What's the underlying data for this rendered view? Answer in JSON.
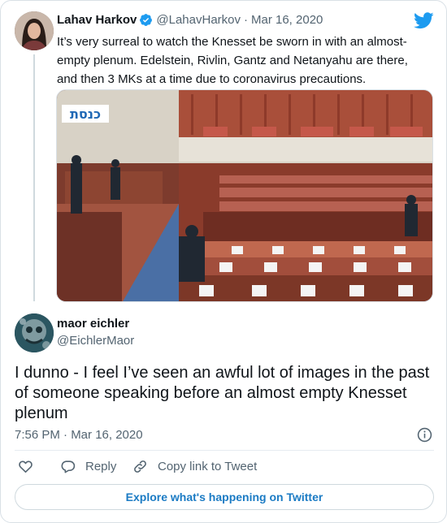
{
  "quoted_tweet": {
    "author_name": "Lahav Harkov",
    "handle": "@LahavHarkov",
    "separator": "·",
    "date": "Mar 16, 2020",
    "text": "It’s very surreal to watch the Knesset be sworn in with an almost-empty plenum. Edelstein, Rivlin, Gantz and Netanyahu are there, and then 3 MKs at a time due to coronavirus precautions.",
    "media_sign_text": "כנסת"
  },
  "tweet": {
    "author_name": "maor eichler",
    "handle": "@EichlerMaor",
    "text": "I dunno - I feel I’ve seen an awful lot of images in the past of someone speaking before an almost empty Knesset plenum",
    "timestamp": "7:56 PM · Mar 16, 2020"
  },
  "actions": {
    "reply_label": "Reply",
    "copy_link_label": "Copy link to Tweet"
  },
  "explore_label": "Explore what's happening on Twitter",
  "icons": [
    "verified-badge-icon",
    "twitter-bird-icon",
    "info-icon",
    "heart-icon",
    "reply-bubble-icon",
    "link-icon"
  ],
  "colors": {
    "brand": "#1d9bf0",
    "text": "#0f1419",
    "muted": "#536471",
    "link": "#1b7bc4",
    "border": "#cfd9de"
  }
}
